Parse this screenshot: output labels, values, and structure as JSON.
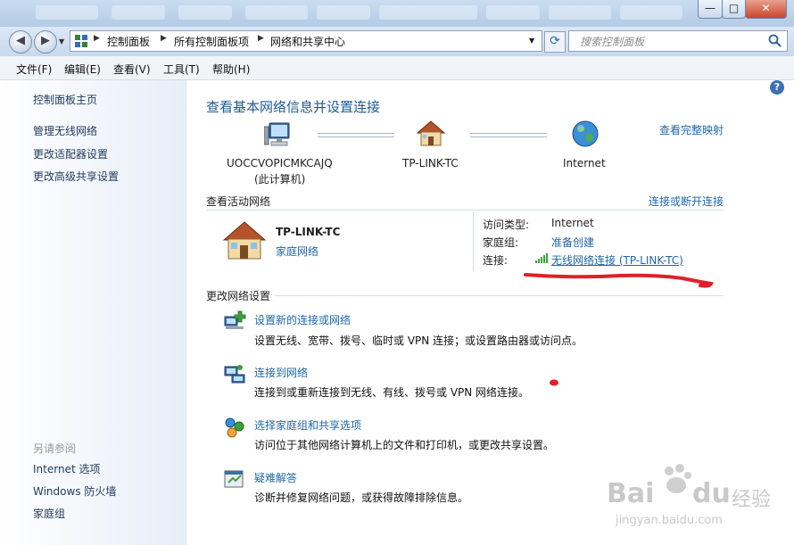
{
  "titlebar": {
    "minimize": "—",
    "maximize": "□",
    "close": "✕"
  },
  "address": {
    "crumbs": [
      "控制面板",
      "所有控制面板项",
      "网络和共享中心"
    ],
    "search_placeholder": "搜索控制面板"
  },
  "menu": [
    "文件(F)",
    "编辑(E)",
    "查看(V)",
    "工具(T)",
    "帮助(H)"
  ],
  "sidebar": {
    "home": "控制面板主页",
    "links": [
      "管理无线网络",
      "更改适配器设置",
      "更改高级共享设置"
    ],
    "see_also_label": "另请参阅",
    "see_also": [
      "Internet 选项",
      "Windows 防火墙",
      "家庭组"
    ]
  },
  "main": {
    "title": "查看基本网络信息并设置连接",
    "full_map": "查看完整映射",
    "map": {
      "computer_name": "UOCCVOPICMKCAJQ",
      "computer_note": "(此计算机)",
      "router": "TP-LINK-TC",
      "internet": "Internet"
    },
    "active_label": "查看活动网络",
    "connect_disconnect": "连接或断开连接",
    "network": {
      "name": "TP-LINK-TC",
      "type": "家庭网络"
    },
    "details": {
      "access_label": "访问类型:",
      "access_value": "Internet",
      "homegroup_label": "家庭组:",
      "homegroup_value": "准备创建",
      "conn_label": "连接:",
      "conn_value": "无线网络连接 (TP-LINK-TC)"
    },
    "change_label": "更改网络设置",
    "items": [
      {
        "title": "设置新的连接或网络",
        "desc": "设置无线、宽带、拨号、临时或 VPN 连接；或设置路由器或访问点。"
      },
      {
        "title": "连接到网络",
        "desc": "连接到或重新连接到无线、有线、拨号或 VPN 网络连接。"
      },
      {
        "title": "选择家庭组和共享选项",
        "desc": "访问位于其他网络计算机上的文件和打印机，或更改共享设置。"
      },
      {
        "title": "疑难解答",
        "desc": "诊断并修复网络问题，或获得故障排除信息。"
      }
    ]
  },
  "watermark": {
    "brand": "Bai",
    "brand2": "du",
    "cn": "经验",
    "url": "jingyan.baidu.com"
  },
  "colors": {
    "link": "#1e67a8",
    "title": "#1e5a94",
    "annotation_red": "#e0202a"
  }
}
